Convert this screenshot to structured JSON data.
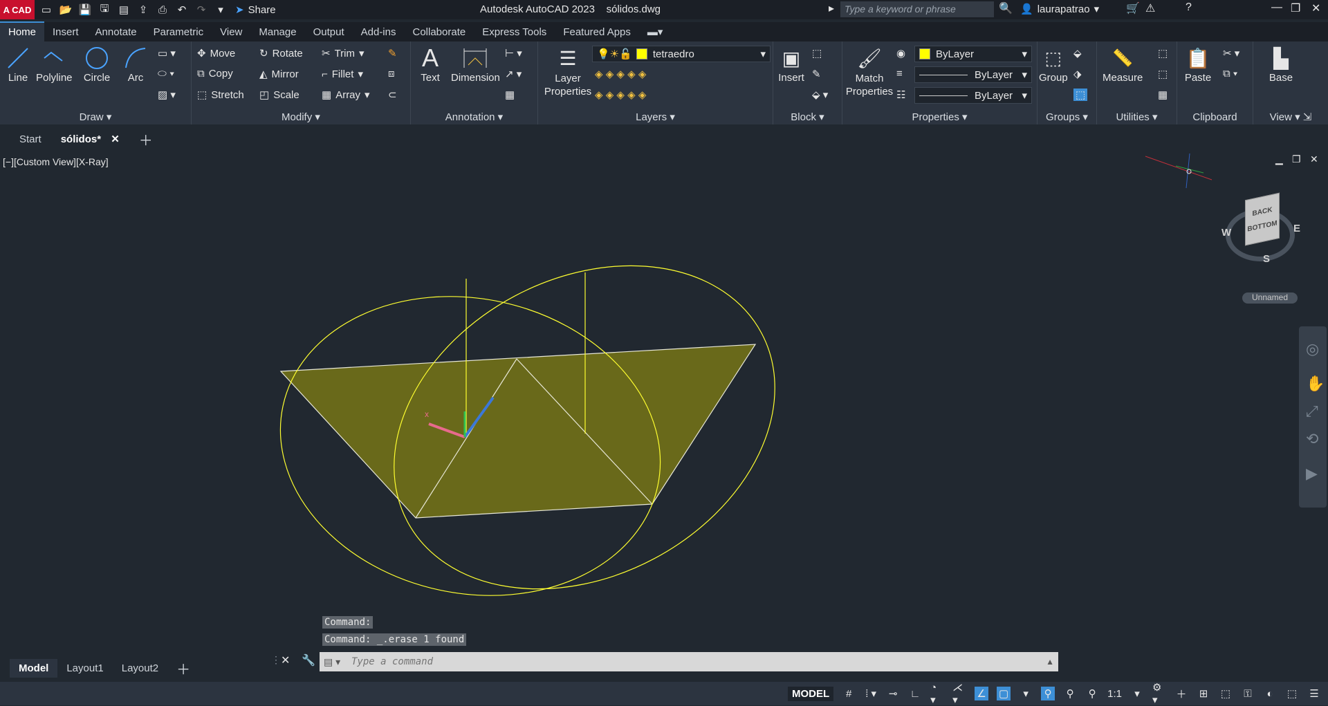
{
  "titlebar": {
    "app_badge": "A CAD",
    "share_label": "Share",
    "app_title": "Autodesk AutoCAD 2023",
    "file_name": "sólidos.dwg",
    "search_placeholder": "Type a keyword or phrase",
    "username": "laurapatrao"
  },
  "ribbon_tabs": [
    "Home",
    "Insert",
    "Annotate",
    "Parametric",
    "View",
    "Manage",
    "Output",
    "Add-ins",
    "Collaborate",
    "Express Tools",
    "Featured Apps"
  ],
  "ribbon": {
    "draw": {
      "label": "Draw",
      "line": "Line",
      "polyline": "Polyline",
      "circle": "Circle",
      "arc": "Arc"
    },
    "modify": {
      "label": "Modify",
      "move": "Move",
      "rotate": "Rotate",
      "trim": "Trim",
      "copy": "Copy",
      "mirror": "Mirror",
      "fillet": "Fillet",
      "stretch": "Stretch",
      "scale": "Scale",
      "array": "Array"
    },
    "annotation": {
      "label": "Annotation",
      "text": "Text",
      "dimension": "Dimension"
    },
    "layers": {
      "label": "Layers",
      "layer_properties": "Layer Properties",
      "current_layer": "tetraedro",
      "layer_color": "#ffff00"
    },
    "block": {
      "label": "Block",
      "insert": "Insert"
    },
    "properties": {
      "label": "Properties",
      "match": "Match Properties",
      "color": "ByLayer",
      "linetype": "ByLayer",
      "lineweight": "ByLayer"
    },
    "groups": {
      "label": "Groups",
      "group": "Group"
    },
    "utilities": {
      "label": "Utilities",
      "measure": "Measure"
    },
    "clipboard": {
      "label": "Clipboard",
      "paste": "Paste"
    },
    "view": {
      "label": "View",
      "base": "Base"
    }
  },
  "doc_tabs": {
    "start": "Start",
    "active": "sólidos*"
  },
  "viewport": {
    "label": "[−][Custom View][X-Ray]",
    "viewcube": {
      "top_face": "BACK",
      "front_face": "BOTTOM",
      "west": "W",
      "east": "E",
      "south": "S",
      "ucs_menu": "Unnamed"
    },
    "object_color": "#ffff00"
  },
  "command": {
    "history": [
      "Command:",
      "Command: _.erase 1 found"
    ],
    "placeholder": "Type a command"
  },
  "layout_tabs": [
    "Model",
    "Layout1",
    "Layout2"
  ],
  "status": {
    "mode": "MODEL",
    "scale": "1:1"
  }
}
